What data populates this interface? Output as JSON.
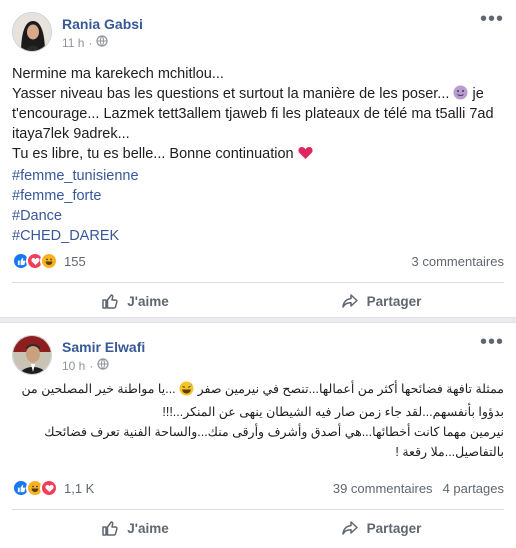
{
  "post1": {
    "author": "Rania Gabsi",
    "time": "11 h",
    "separator": "·",
    "lines": [
      "Nermine ma karekech mchitlou...",
      "Yasser niveau bas les questions et surtout la manière de les poser...",
      "je",
      "t'encourage... Lazmek tett3allem tjaweb fi les plateaux de télé ma t5alli 7ad",
      "itaya7lek 9adrek...",
      "Tu es libre, tu es belle... Bonne continuation"
    ],
    "hashtags": [
      "#femme_tunisienne",
      "#femme_forte",
      "#Dance",
      "#CHED_DAREK"
    ],
    "reaction_count": "155",
    "comments": "3 commentaires",
    "like_label": "J'aime",
    "share_label": "Partager"
  },
  "post2": {
    "author": "Samir Elwafi",
    "time": "10 h",
    "separator": "·",
    "text_a": "ممثلة تافهة فضائحها أكثر من أعمالها...تنصح في نيرمين صفر",
    "text_b": "...يا مواطنة خير المصلحين من بدؤوا بأنفسهم...لقد جاء زمن صار فيه الشيطان ينهى عن المنكر...!!!",
    "text_c": "نيرمين مهما كانت أخطائها...هي أصدق وأشرف وأرقى منك...والساحة الفنية تعرف فضائحك بالتفاصيل...ملا رقعة !",
    "reaction_count": "1,1 K",
    "comments": "39 commentaires",
    "shares": "4 partages",
    "like_label": "J'aime",
    "share_label": "Partager"
  },
  "colors": {
    "link": "#385898",
    "like": "#1877f2",
    "love": "#f33e58",
    "haha": "#f7b125",
    "muted": "#606770"
  },
  "icons": {
    "more": "more-options-icon",
    "globe": "globe-icon",
    "like": "thumbs-up-icon",
    "share": "share-arrow-icon"
  }
}
